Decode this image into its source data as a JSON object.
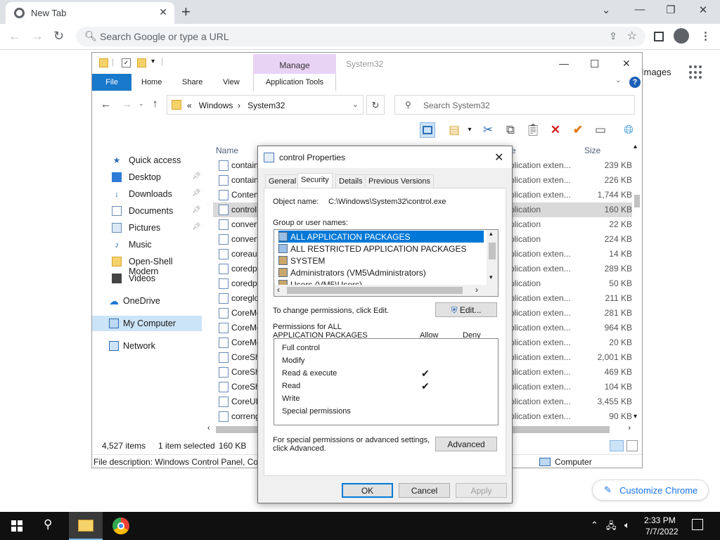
{
  "chrome": {
    "tab_title": "New Tab",
    "omnibox_placeholder": "Search Google or type a URL",
    "images_link": "Images",
    "customize_label": "Customize Chrome"
  },
  "explorer": {
    "manage_label": "Manage",
    "title_path": "System32",
    "ribbon_tabs": [
      "File",
      "Home",
      "Share",
      "View",
      "Application Tools"
    ],
    "address": {
      "prefix": "«",
      "parts": [
        "Windows",
        "System32"
      ]
    },
    "search_placeholder": "Search System32",
    "nav_items": [
      {
        "label": "Quick access",
        "pinned": false
      },
      {
        "label": "Desktop",
        "pinned": true
      },
      {
        "label": "Downloads",
        "pinned": true
      },
      {
        "label": "Documents",
        "pinned": true
      },
      {
        "label": "Pictures",
        "pinned": true
      },
      {
        "label": "Music",
        "pinned": false
      },
      {
        "label": "Open-Shell Modern",
        "pinned": false
      },
      {
        "label": "Videos",
        "pinned": false
      },
      {
        "label": "OneDrive",
        "pinned": false
      },
      {
        "label": "My Computer",
        "pinned": false,
        "selected": true
      },
      {
        "label": "Network",
        "pinned": false
      }
    ],
    "columns": {
      "name": "Name",
      "type": "e",
      "size": "Size"
    },
    "files": [
      {
        "name": "contain",
        "type": "plication exten...",
        "size": "239 KB"
      },
      {
        "name": "contain",
        "type": "plication exten...",
        "size": "226 KB"
      },
      {
        "name": "Conten",
        "type": "plication exten...",
        "size": "1,744 KB"
      },
      {
        "name": "control",
        "type": "plication",
        "size": "160 KB",
        "selected": true
      },
      {
        "name": "convert",
        "type": "plication",
        "size": "22 KB"
      },
      {
        "name": "convert",
        "type": "plication",
        "size": "224 KB"
      },
      {
        "name": "coreauc",
        "type": "plication exten...",
        "size": "14 KB"
      },
      {
        "name": "coredpu",
        "type": "plication exten...",
        "size": "289 KB"
      },
      {
        "name": "coredpu",
        "type": "plication",
        "size": "50 KB"
      },
      {
        "name": "coreglo",
        "type": "plication exten...",
        "size": "211 KB"
      },
      {
        "name": "CoreMe",
        "type": "plication exten...",
        "size": "281 KB"
      },
      {
        "name": "CoreMe",
        "type": "plication exten...",
        "size": "964 KB"
      },
      {
        "name": "CoreMe",
        "type": "plication exten...",
        "size": "20 KB"
      },
      {
        "name": "CoreSh",
        "type": "plication exten...",
        "size": "2,001 KB"
      },
      {
        "name": "CoreSh",
        "type": "plication exten...",
        "size": "469 KB"
      },
      {
        "name": "CoreSh",
        "type": "plication exten...",
        "size": "104 KB"
      },
      {
        "name": "CoreUI",
        "type": "plication exten...",
        "size": "3,455 KB"
      },
      {
        "name": "correng",
        "type": "plication exten...",
        "size": "90 KB"
      }
    ],
    "status": {
      "items": "4,527 items",
      "selected": "1 item selected",
      "size": "160 KB"
    },
    "description": "File description: Windows Control Panel, Co",
    "location": "Computer"
  },
  "dialog": {
    "title": "control Properties",
    "tabs": [
      "General",
      "Security",
      "Details",
      "Previous Versions"
    ],
    "active_tab": "Security",
    "object_label": "Object name:",
    "object_value": "C:\\Windows\\System32\\control.exe",
    "group_label": "Group or user names:",
    "users": [
      {
        "name": "ALL APPLICATION PACKAGES",
        "selected": true
      },
      {
        "name": "ALL RESTRICTED APPLICATION PACKAGES"
      },
      {
        "name": "SYSTEM"
      },
      {
        "name": "Administrators (VM5\\Administrators)"
      },
      {
        "name": "Users (VM5\\Users)"
      }
    ],
    "change_text": "To change permissions, click Edit.",
    "edit_button": "Edit...",
    "perm_for_line1": "Permissions for ALL",
    "perm_for_line2": "APPLICATION PACKAGES",
    "allow_header": "Allow",
    "deny_header": "Deny",
    "permissions": [
      {
        "name": "Full control",
        "allow": "",
        "deny": ""
      },
      {
        "name": "Modify",
        "allow": "",
        "deny": ""
      },
      {
        "name": "Read & execute",
        "allow": "✔",
        "deny": ""
      },
      {
        "name": "Read",
        "allow": "✔",
        "deny": ""
      },
      {
        "name": "Write",
        "allow": "",
        "deny": ""
      },
      {
        "name": "Special permissions",
        "allow": "",
        "deny": ""
      }
    ],
    "special_line1": "For special permissions or advanced settings,",
    "special_line2": "click Advanced.",
    "advanced_button": "Advanced",
    "ok_button": "OK",
    "cancel_button": "Cancel",
    "apply_button": "Apply"
  },
  "taskbar": {
    "time": "2:33 PM",
    "date": "7/7/2022"
  },
  "colors": {
    "accent": "#0078d7",
    "file_tab": "#1979ca",
    "manage_tab": "#e9d3f5",
    "chrome_link": "#1a73e8"
  }
}
